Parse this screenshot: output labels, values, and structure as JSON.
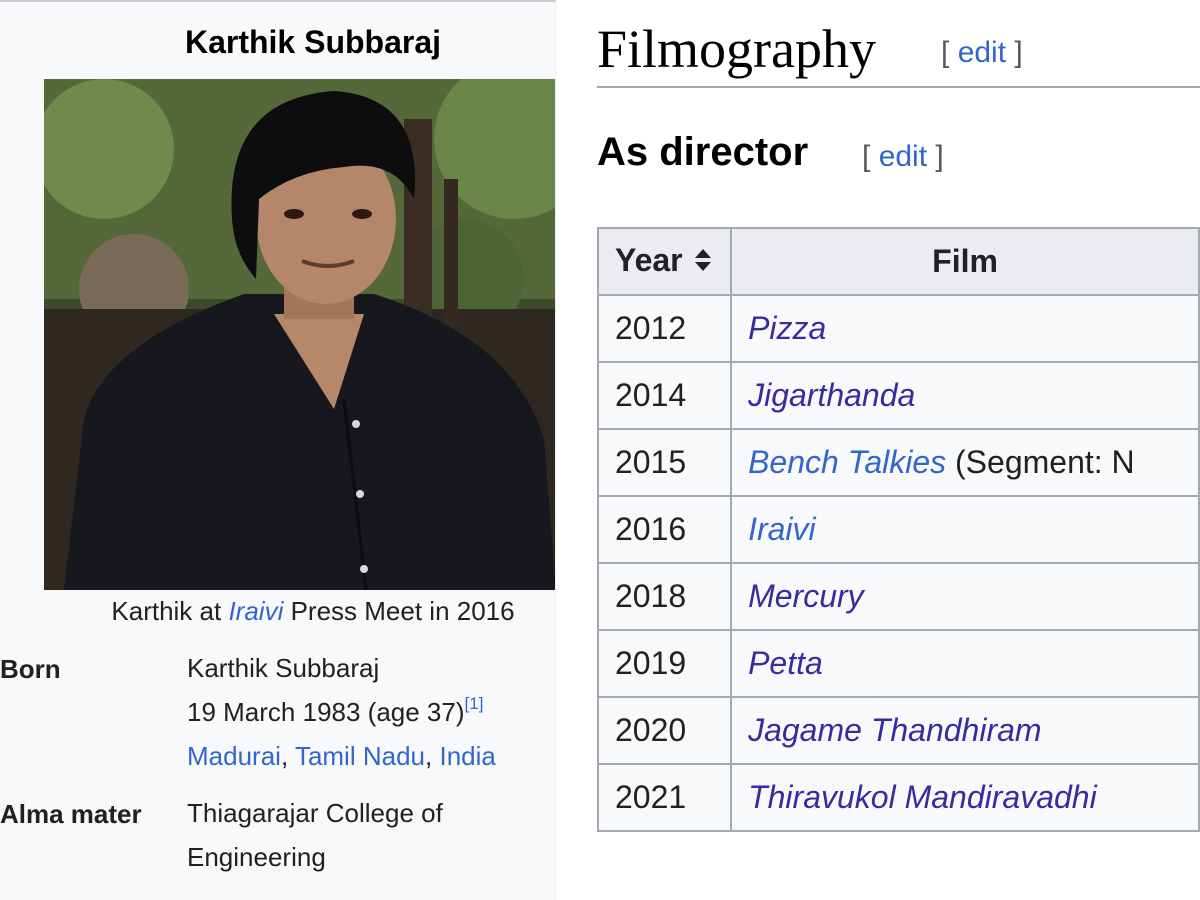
{
  "infobox": {
    "name": "Karthik Subbaraj",
    "photo_alt": "Karthik Subbaraj",
    "caption": {
      "prefix": "Karthik at",
      "link": "Iraivi",
      "suffix": "Press Meet in 2016"
    },
    "born": {
      "label": "Born",
      "name": "Karthik Subbaraj",
      "date": "19 March 1983 (age 37)",
      "ref": "[1]",
      "place_1": "Madurai",
      "sep_1": ",",
      "place_2": "Tamil Nadu",
      "sep_2": ",",
      "place_3": "India"
    },
    "alma_mater": {
      "label": "Alma mater",
      "line_1": "Thiagarajar College of",
      "line_2": "Engineering"
    }
  },
  "filmography": {
    "heading": "Filmography",
    "edit": {
      "open": "[",
      "label": "edit",
      "close": "]"
    },
    "sub_heading": "As director",
    "sub_edit": {
      "open": "[",
      "label": "edit",
      "close": "]"
    },
    "columns": {
      "year": "Year",
      "film": "Film"
    },
    "rows": [
      {
        "year": "2012",
        "film": "Pizza",
        "note": ""
      },
      {
        "year": "2014",
        "film": "Jigarthanda",
        "note": ""
      },
      {
        "year": "2015",
        "film": "Bench Talkies",
        "note": "(Segment: N"
      },
      {
        "year": "2016",
        "film": "Iraivi",
        "note": ""
      },
      {
        "year": "2018",
        "film": "Mercury",
        "note": ""
      },
      {
        "year": "2019",
        "film": "Petta",
        "note": ""
      },
      {
        "year": "2020",
        "film": "Jagame Thandhiram",
        "note": ""
      },
      {
        "year": "2021",
        "film": "Thiravukol Mandiravadhi",
        "note": ""
      }
    ]
  },
  "colors": {
    "link_blue": "#3366cc",
    "visited_link": "#3a2aa0",
    "table_border": "#a2a9b1",
    "header_bg": "#eaecf0",
    "infobox_bg": "#f8f9fa"
  },
  "icons": {
    "sort": "sort-icon"
  }
}
